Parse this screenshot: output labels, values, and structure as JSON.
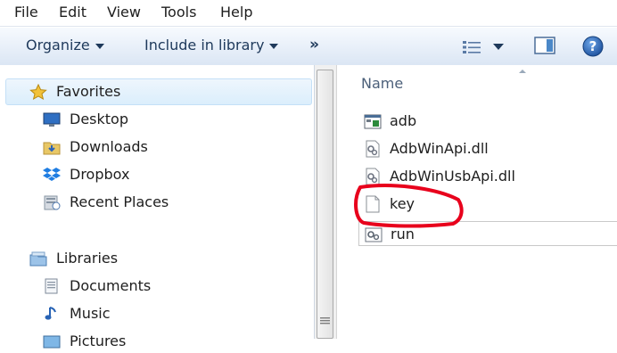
{
  "menu": [
    "File",
    "Edit",
    "View",
    "Tools",
    "Help"
  ],
  "toolbar": {
    "organize": "Organize",
    "include_in_library": "Include in library",
    "more": "»"
  },
  "nav": {
    "favorites": {
      "label": "Favorites",
      "items": [
        "Desktop",
        "Downloads",
        "Dropbox",
        "Recent Places"
      ]
    },
    "libraries": {
      "label": "Libraries",
      "items": [
        "Documents",
        "Music",
        "Pictures"
      ]
    }
  },
  "files": {
    "column_name": "Name",
    "items": [
      "adb",
      "AdbWinApi.dll",
      "AdbWinUsbApi.dll",
      "key",
      "run"
    ]
  },
  "colors": {
    "annotation": "#e8001c",
    "accent": "#1e395b",
    "selection": "#dbeefc"
  }
}
